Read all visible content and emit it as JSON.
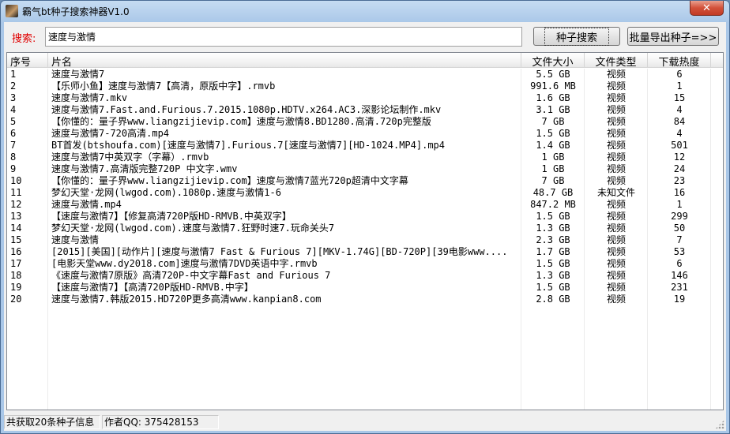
{
  "window": {
    "title": "霸气bt种子搜索神器V1.0",
    "close_glyph": "✕"
  },
  "search": {
    "label": "搜索:",
    "value": "速度与激情",
    "search_button": "种子搜索",
    "export_button": "批量导出种子=>>"
  },
  "table": {
    "columns": [
      "序号",
      "片名",
      "文件大小",
      "文件类型",
      "下载热度"
    ],
    "rows": [
      {
        "idx": "1",
        "name": "速度与激情7",
        "size": "5.5 GB",
        "type": "视频",
        "heat": "6"
      },
      {
        "idx": "2",
        "name": "【乐师小鱼】速度与激情7【高清，原版中字】.rmvb",
        "size": "991.6 MB",
        "type": "视频",
        "heat": "1"
      },
      {
        "idx": "3",
        "name": "速度与激情7.mkv",
        "size": "1.6 GB",
        "type": "视频",
        "heat": "15"
      },
      {
        "idx": "4",
        "name": "速度与激情7.Fast.and.Furious.7.2015.1080p.HDTV.x264.AC3.深影论坛制作.mkv",
        "size": "3.1 GB",
        "type": "视频",
        "heat": "4"
      },
      {
        "idx": "5",
        "name": "【你懂的：量子界www.liangzijievip.com】速度与激情8.BD1280.高清.720p完整版",
        "size": "7 GB",
        "type": "视频",
        "heat": "84"
      },
      {
        "idx": "6",
        "name": "速度与激情7-720高清.mp4",
        "size": "1.5 GB",
        "type": "视频",
        "heat": "4"
      },
      {
        "idx": "7",
        "name": "BT首发(btshoufa.com)[速度与激情7].Furious.7[速度与激情7][HD-1024.MP4].mp4",
        "size": "1.4 GB",
        "type": "视频",
        "heat": "501"
      },
      {
        "idx": "8",
        "name": "速度与激情7中英双字（字幕）.rmvb",
        "size": "1 GB",
        "type": "视频",
        "heat": "12"
      },
      {
        "idx": "9",
        "name": "速度与激情7.高清版完整720P 中文字.wmv",
        "size": "1 GB",
        "type": "视频",
        "heat": "24"
      },
      {
        "idx": "10",
        "name": "【你懂的：量子界www.liangzijievip.com】速度与激情7蓝光720p超清中文字幕",
        "size": "7 GB",
        "type": "视频",
        "heat": "23"
      },
      {
        "idx": "11",
        "name": "梦幻天堂·龙网(lwgod.com).1080p.速度与激情1-6",
        "size": "48.7 GB",
        "type": "未知文件",
        "heat": "16"
      },
      {
        "idx": "12",
        "name": "速度与激情.mp4",
        "size": "847.2 MB",
        "type": "视频",
        "heat": "1"
      },
      {
        "idx": "13",
        "name": "【速度与激情7】【修复高清720P版HD-RMVB.中英双字】",
        "size": "1.5 GB",
        "type": "视频",
        "heat": "299"
      },
      {
        "idx": "14",
        "name": "梦幻天堂·龙网(lwgod.com).速度与激情7.狂野时速7.玩命关头7",
        "size": "1.3 GB",
        "type": "视频",
        "heat": "50"
      },
      {
        "idx": "15",
        "name": "速度与激情",
        "size": "2.3 GB",
        "type": "视频",
        "heat": "7"
      },
      {
        "idx": "16",
        "name": "[2015][美国][动作片][速度与激情7 Fast & Furious 7][MKV-1.74G][BD-720P][39电影www....",
        "size": "1.7 GB",
        "type": "视频",
        "heat": "53"
      },
      {
        "idx": "17",
        "name": "[电影天堂www.dy2018.com]速度与激情7DVD英语中字.rmvb",
        "size": "1.5 GB",
        "type": "视频",
        "heat": "6"
      },
      {
        "idx": "18",
        "name": "《速度与激情7原版》高清720P-中文字幕Fast and Furious 7",
        "size": "1.3 GB",
        "type": "视频",
        "heat": "146"
      },
      {
        "idx": "19",
        "name": "【速度与激情7】【高清720P版HD-RMVB.中字】",
        "size": "1.5 GB",
        "type": "视频",
        "heat": "231"
      },
      {
        "idx": "20",
        "name": "速度与激情7.韩版2015.HD720P更多高清www.kanpian8.com",
        "size": "2.8 GB",
        "type": "视频",
        "heat": "19"
      }
    ]
  },
  "status": {
    "count_text": "共获取20条种子信息",
    "author_text": "作者QQ: 375428153"
  }
}
